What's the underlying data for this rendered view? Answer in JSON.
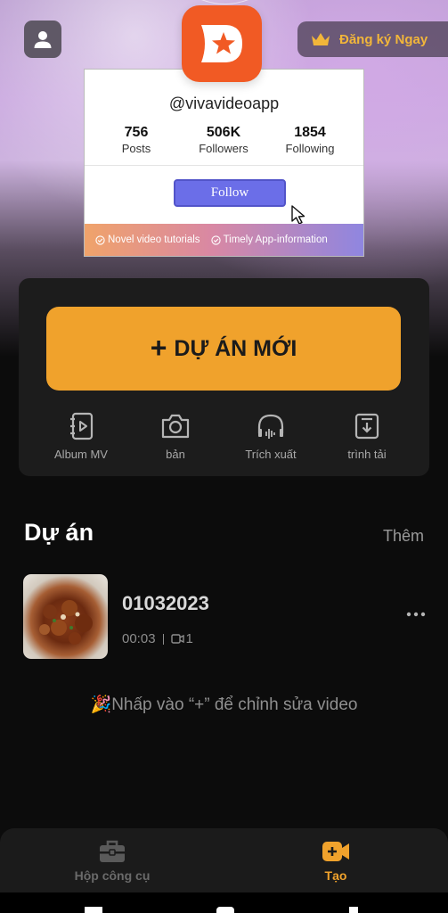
{
  "header": {
    "subscribe_label": "Đăng ký Ngay",
    "colors": {
      "accent": "#f0a22c",
      "subscribe_text": "#f2b63a",
      "logo": "#f15a24"
    }
  },
  "promo_card": {
    "handle": "@vivavideoapp",
    "stats": [
      {
        "value": "756",
        "label": "Posts"
      },
      {
        "value": "506K",
        "label": "Followers"
      },
      {
        "value": "1854",
        "label": "Following"
      }
    ],
    "follow_label": "Follow",
    "features": [
      "Novel video tutorials",
      "Timely App-information"
    ]
  },
  "actions": {
    "new_project_label": "DỰ ÁN MỚI",
    "quick_tools": [
      {
        "label": "Album MV",
        "icon": "album-mv-icon"
      },
      {
        "label": "bản",
        "icon": "camera-icon"
      },
      {
        "label": "Trích xuất",
        "icon": "audio-extract-icon"
      },
      {
        "label": "trình tải",
        "icon": "download-icon"
      }
    ]
  },
  "projects": {
    "title": "Dự án",
    "more_label": "Thêm",
    "items": [
      {
        "name": "01032023",
        "duration": "00:03",
        "clip_count": "1"
      }
    ],
    "hint": "🎉Nhấp vào “+” để chỉnh sửa video"
  },
  "bottom_nav": {
    "items": [
      {
        "label": "Hộp công cụ",
        "icon": "toolbox-icon",
        "active": false
      },
      {
        "label": "Tạo",
        "icon": "create-video-icon",
        "active": true
      }
    ]
  }
}
